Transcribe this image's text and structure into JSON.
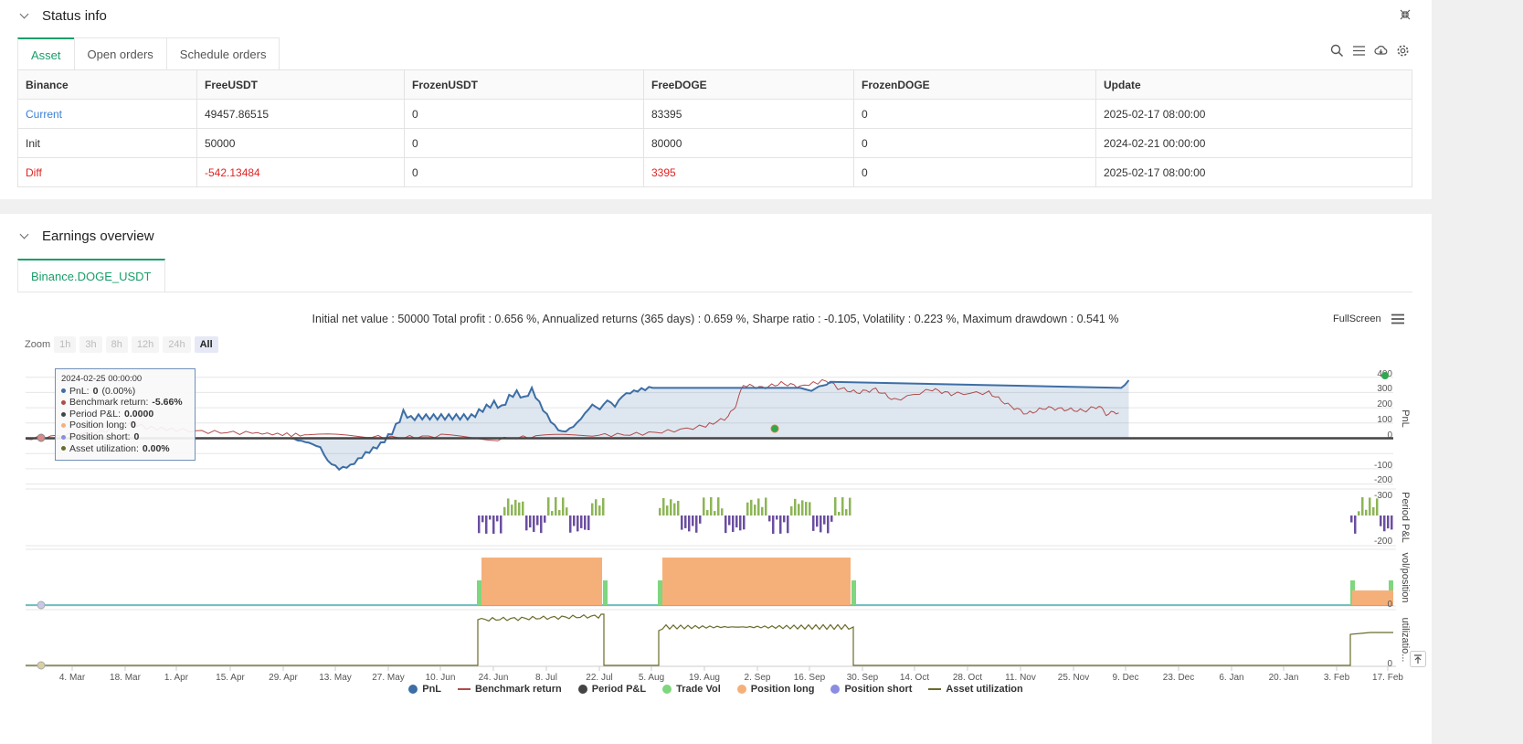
{
  "status": {
    "title": "Status info",
    "tabs": [
      "Asset",
      "Open orders",
      "Schedule orders"
    ],
    "headers": [
      "Binance",
      "FreeUSDT",
      "FrozenUSDT",
      "FreeDOGE",
      "FrozenDOGE",
      "Update"
    ],
    "rows": [
      [
        "Current",
        "49457.86515",
        "0",
        "83395",
        "0",
        "2025-02-17 08:00:00"
      ],
      [
        "Init",
        "50000",
        "0",
        "80000",
        "0",
        "2024-02-21 00:00:00"
      ],
      [
        "Diff",
        "-542.13484",
        "0",
        "3395",
        "0",
        "2025-02-17 08:00:00"
      ]
    ]
  },
  "earnings": {
    "title": "Earnings overview",
    "tab": "Binance.DOGE_USDT",
    "summary": "Initial net value : 50000 Total profit : 0.656 %, Annualized returns (365 days) : 0.659 %, Sharpe ratio : -0.105, Volatility : 0.223 %, Maximum drawdown : 0.541 %",
    "fullscreen": "FullScreen",
    "zoom_label": "Zoom",
    "zoom_options": [
      "1h",
      "3h",
      "8h",
      "12h",
      "24h",
      "All"
    ],
    "zoom_selected": "All"
  },
  "tooltip": {
    "date": "2024-02-25 00:00:00",
    "pnl_label": "PnL: ",
    "pnl_value": "0",
    "pnl_pct": " (0.00%)",
    "bench_label": "Benchmark return: ",
    "bench_value": "-5.66%",
    "period_label": "Period P&L: ",
    "period_value": "0.0000",
    "long_label": "Position long: ",
    "long_value": "0",
    "short_label": "Position short: ",
    "short_value": "0",
    "util_label": "Asset utilization: ",
    "util_value": "0.00%"
  },
  "colors": {
    "pnl": "#3d6ea5",
    "benchmark": "#b34a4a",
    "period": "#444444",
    "tradevol": "#7ed67e",
    "long": "#f5b07a",
    "short": "#8a8de0",
    "util": "#6b6b2a",
    "accent": "#1a9e6a"
  },
  "chart_data": {
    "type": "line",
    "x_ticks": [
      "4. Mar",
      "18. Mar",
      "1. Apr",
      "15. Apr",
      "29. Apr",
      "13. May",
      "27. May",
      "10. Jun",
      "24. Jun",
      "8. Jul",
      "22. Jul",
      "5. Aug",
      "19. Aug",
      "2. Sep",
      "16. Sep",
      "30. Sep",
      "14. Oct",
      "28. Oct",
      "11. Nov",
      "25. Nov",
      "9. Dec",
      "23. Dec",
      "6. Jan",
      "20. Jan",
      "3. Feb",
      "17. Feb"
    ],
    "pnl_axis": {
      "label": "PnL",
      "ticks": [
        "400",
        "300",
        "200",
        "100",
        "0",
        "-100",
        "-200",
        "-300"
      ]
    },
    "period_axis": {
      "label": "Period P&L",
      "ticks": [
        "-200"
      ]
    },
    "vol_axis": {
      "label": "vol/position",
      "ticks": [
        "0"
      ]
    },
    "util_axis": {
      "label": "utilizatio...",
      "ticks": [
        "0"
      ]
    },
    "series": [
      {
        "name": "PnL"
      },
      {
        "name": "Benchmark return"
      },
      {
        "name": "Period P&L"
      },
      {
        "name": "Trade Vol"
      },
      {
        "name": "Position long"
      },
      {
        "name": "Position short"
      },
      {
        "name": "Asset utilization"
      }
    ],
    "pnl_points": [
      [
        0,
        0
      ],
      [
        70,
        0
      ],
      [
        75,
        -30
      ],
      [
        78,
        -60
      ],
      [
        80,
        -150
      ],
      [
        83,
        -200
      ],
      [
        86,
        -180
      ],
      [
        90,
        -100
      ],
      [
        94,
        -40
      ],
      [
        97,
        40
      ],
      [
        99,
        120
      ],
      [
        100,
        170
      ],
      [
        102,
        130
      ],
      [
        104,
        140
      ],
      [
        110,
        140
      ],
      [
        118,
        140
      ],
      [
        121,
        190
      ],
      [
        124,
        230
      ],
      [
        126,
        200
      ],
      [
        128,
        270
      ],
      [
        130,
        300
      ],
      [
        132,
        260
      ],
      [
        134,
        320
      ],
      [
        136,
        230
      ],
      [
        138,
        150
      ],
      [
        140,
        80
      ],
      [
        142,
        40
      ],
      [
        144,
        60
      ],
      [
        146,
        100
      ],
      [
        148,
        160
      ],
      [
        150,
        220
      ],
      [
        152,
        190
      ],
      [
        154,
        250
      ],
      [
        156,
        210
      ],
      [
        158,
        280
      ],
      [
        160,
        300
      ],
      [
        163,
        320
      ],
      [
        166,
        330
      ],
      [
        200,
        330
      ],
      [
        205,
        330
      ],
      [
        208,
        310
      ],
      [
        210,
        340
      ],
      [
        212,
        350
      ],
      [
        214,
        390
      ]
    ],
    "bench_points": [
      [
        0,
        -5.66
      ],
      [
        10,
        20
      ],
      [
        20,
        40
      ],
      [
        28,
        100
      ],
      [
        32,
        70
      ],
      [
        40,
        55
      ],
      [
        50,
        40
      ],
      [
        60,
        35
      ],
      [
        68,
        25
      ],
      [
        75,
        20
      ],
      [
        90,
        10
      ],
      [
        100,
        5
      ],
      [
        110,
        15
      ],
      [
        125,
        -5
      ],
      [
        135,
        10
      ],
      [
        150,
        20
      ],
      [
        160,
        25
      ],
      [
        170,
        45
      ],
      [
        180,
        80
      ],
      [
        186,
        140
      ],
      [
        188,
        220
      ],
      [
        190,
        350
      ],
      [
        195,
        330
      ],
      [
        200,
        360
      ],
      [
        205,
        340
      ],
      [
        212,
        380
      ],
      [
        215,
        330
      ],
      [
        220,
        300
      ],
      [
        225,
        320
      ],
      [
        230,
        250
      ],
      [
        240,
        320
      ],
      [
        245,
        290
      ],
      [
        255,
        300
      ],
      [
        260,
        220
      ],
      [
        265,
        160
      ],
      [
        270,
        200
      ],
      [
        275,
        190
      ],
      [
        280,
        180
      ],
      [
        284,
        210
      ],
      [
        286,
        160
      ],
      [
        290,
        175
      ]
    ]
  }
}
